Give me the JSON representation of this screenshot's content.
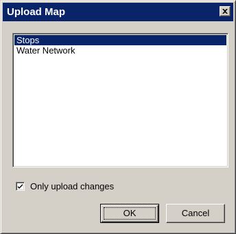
{
  "window": {
    "title": "Upload Map",
    "close_icon": "close-icon"
  },
  "map_list": {
    "items": [
      {
        "label": "Stops",
        "selected": true
      },
      {
        "label": "Water Network",
        "selected": false
      }
    ]
  },
  "options": {
    "only_upload_changes_label": "Only upload changes",
    "only_upload_changes_checked": true
  },
  "buttons": {
    "ok_label": "OK",
    "cancel_label": "Cancel"
  },
  "colors": {
    "titlebar": "#0a246a",
    "face": "#d4d0c8",
    "selection": "#0a246a"
  }
}
